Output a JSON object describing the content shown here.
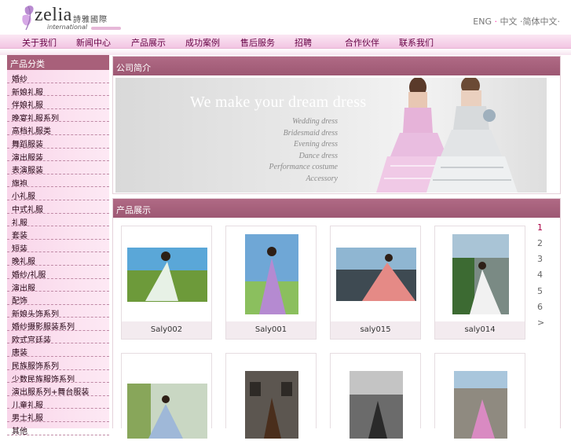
{
  "brand": {
    "logo_word": "zelia",
    "logo_cn": "詩雅國際",
    "logo_sub": "international"
  },
  "lang": {
    "eng": "ENG",
    "sep": "·",
    "links": "中文 ·简体中文",
    "dot": "·"
  },
  "nav": [
    "关于我们",
    "新闻中心",
    "产品展示",
    "成功案例",
    "售后服务",
    "招聘",
    "合作伙伴",
    "联系我们"
  ],
  "sidebar": {
    "title": "产品分类",
    "items": [
      "婚纱",
      "新娘礼服",
      "伴娘礼服",
      "晚宴礼服系列",
      "高档礼服类",
      "舞蹈服装",
      "演出服装",
      "表演服装",
      "旗袍",
      "小礼服",
      "中式礼服",
      "礼服",
      "套装",
      "短装",
      "晚礼服",
      "婚纱/礼服",
      "演出服",
      "配饰",
      "新娘头饰系列",
      "婚纱摄影服装系列",
      "欧式宫廷装",
      "唐装",
      "民族服饰系列",
      "少数民族服饰系列",
      "演出服系列+舞台服装",
      "儿童礼服",
      "男士礼服",
      "其他"
    ]
  },
  "about": {
    "title": "公司简介",
    "banner_title": "We make your dream dress",
    "banner_lines": [
      "Wedding dress",
      "Bridesmaid dress",
      "Evening dress",
      "Dance dress",
      "Performance costume",
      "Accessory"
    ]
  },
  "products": {
    "title": "产品展示",
    "row1": [
      "Saly002",
      "Saly001",
      "saly015",
      "saly014"
    ],
    "pages": [
      "1",
      "2",
      "3",
      "4",
      "5",
      "6",
      ">"
    ]
  },
  "colors": {
    "accent": "#a8607a",
    "nav_bg": "#f2c5e3",
    "sidebar_bg": "#f9d6ea"
  }
}
